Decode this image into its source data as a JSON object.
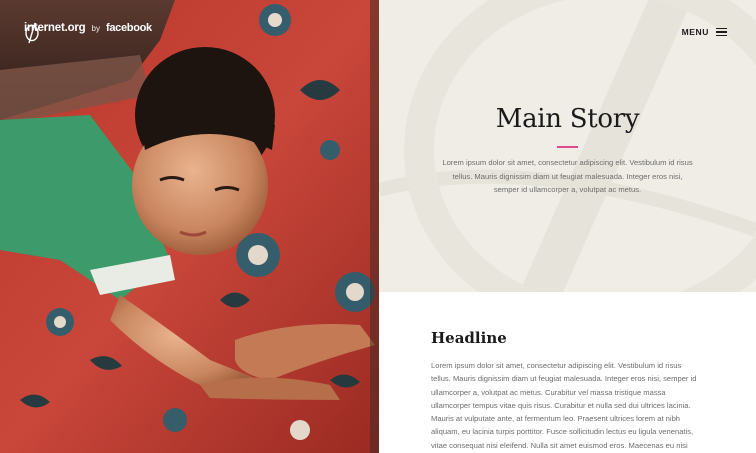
{
  "brand": {
    "site": "internet.org",
    "by": "by",
    "partner": "facebook",
    "logo_icon": "internet-org-logo-icon"
  },
  "nav": {
    "menu_label": "MENU",
    "menu_icon": "hamburger-icon"
  },
  "hero": {
    "title": "Main Story",
    "accent_color": "#e0488f",
    "background_color": "#efede6",
    "intro": "Lorem ipsum dolor sit amet, consectetur adipiscing elit. Vestibulum id risus tellus. Mauris dignissim diam ut feugiat malesuada. Integer eros nisi, semper id ullamcorper a, volutpat ac metus."
  },
  "article": {
    "headline": "Headline",
    "body": "Lorem ipsum dolor sit amet, consectetur adipiscing elit. Vestibulum id risus tellus. Mauris dignissim diam ut feugiat malesuada. Integer eros nisi, semper id ullamcorper a, volutpat ac metus. Curabitur vel massa tristique massa ullamcorper tempus vitae quis risus. Curabitur et nulla sed dui ultrices lacinia. Mauris at vulputate ante, at fermentum leo. Praesent ultrices lorem at nibh aliquam, eu lacinia turpis porttitor. Fusce sollicitudin lectus eu ligula venenatis, vitae consequat nisi eleifend. Nulla sit amet euismod eros. Maecenas eu nisi"
  },
  "photo": {
    "subject": "child-resting-on-floral-dress-photo"
  }
}
